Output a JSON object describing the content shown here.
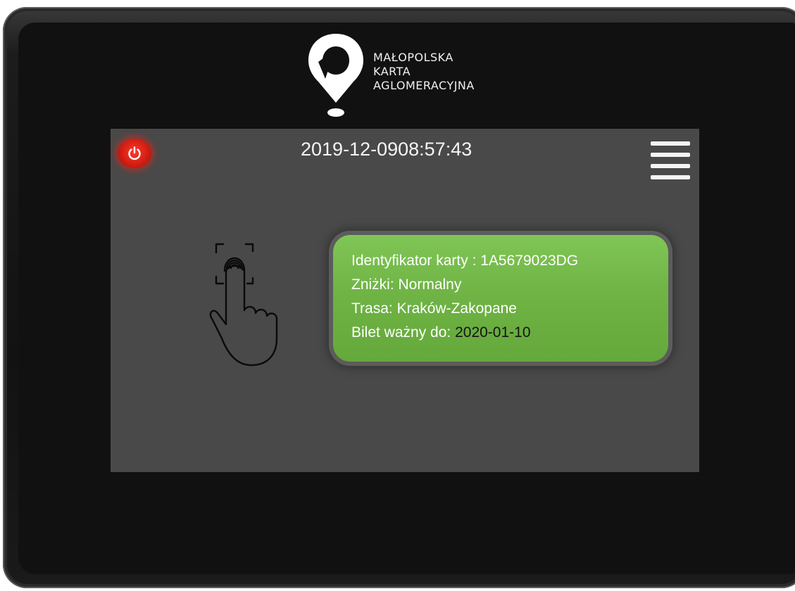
{
  "brand": {
    "line1": "MAŁOPOLSKA",
    "line2": "KARTA",
    "line3": "AGLOMERACYJNA",
    "logo_icon": "map-pin-logo-icon"
  },
  "header": {
    "date": "2019-12-09",
    "time": "08:57:43",
    "power_icon": "power-icon",
    "menu_icon": "hamburger-menu-icon",
    "power_color": "#e02416"
  },
  "touch_prompt": {
    "icon": "fingerprint-touch-icon"
  },
  "card": {
    "id_label": "Identyfikator karty : 1A5679023DG",
    "discount_label": "Zniżki: Normalny",
    "route_label": "Trasa: Kraków-Zakopane",
    "valid_label": "Bilet ważny do:",
    "valid_date": "2020-01-10",
    "background_color": "#6fb445"
  },
  "colors": {
    "screen_bg": "#494949",
    "bezel": "#111111"
  }
}
